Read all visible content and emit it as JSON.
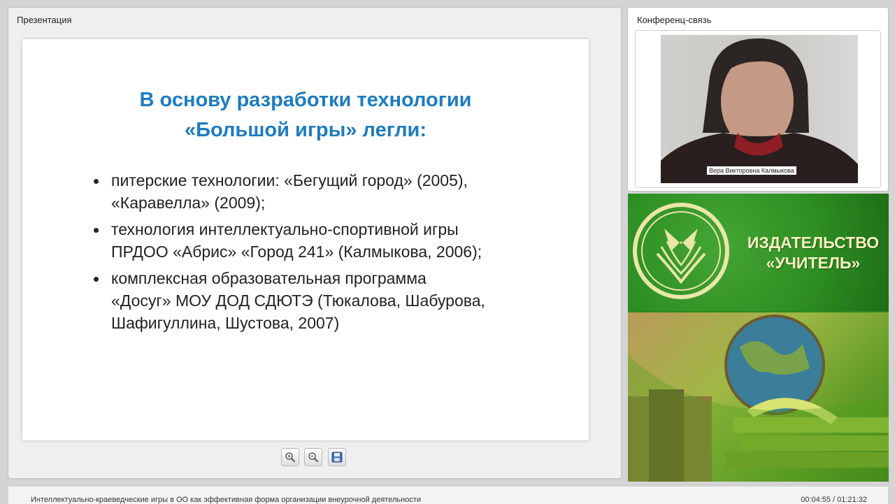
{
  "presentation": {
    "panel_title": "Презентация",
    "slide": {
      "title_line1": "В основу разработки технологии",
      "title_line2": "«Большой игры» легли:",
      "bullets": [
        {
          "line1": "питерские технологии: «Бегущий город» (2005),",
          "line2": "«Каравелла» (2009);"
        },
        {
          "line1": "технология интеллектуально-спортивной игры",
          "line2": "ПРДОО «Абрис» «Город 241» (Калмыкова, 2006);"
        },
        {
          "line1": "комплексная образовательная программа",
          "line2": "«Досуг» МОУ ДОД СДЮТЭ (Тюкалова, Шабурова,",
          "line3": "Шафигуллина, Шустова, 2007)"
        }
      ]
    },
    "toolbar": [
      {
        "name": "zoom-in",
        "icon": "zoom-in-icon"
      },
      {
        "name": "zoom-out",
        "icon": "zoom-out-icon"
      },
      {
        "name": "save",
        "icon": "floppy-disk-icon"
      }
    ]
  },
  "conference": {
    "panel_title": "Конференц-связь",
    "speaker_name": "Вера Викторовна Калмыкова"
  },
  "publisher": {
    "name_line1": "ИЗДАТЕЛЬСТВО",
    "name_line2": "«УЧИТЕЛЬ»",
    "brand_green": "#2d8e22",
    "text_color": "#f6f0c0"
  },
  "statusbar": {
    "title": "Интеллектуально-краеведческие игры в ОО как эффективная форма организации внеурочной деятельности",
    "time": "00:04:55 / 01:21:32"
  },
  "colors": {
    "slide_title": "#1c7cc0",
    "background": "#d4d4d4"
  }
}
